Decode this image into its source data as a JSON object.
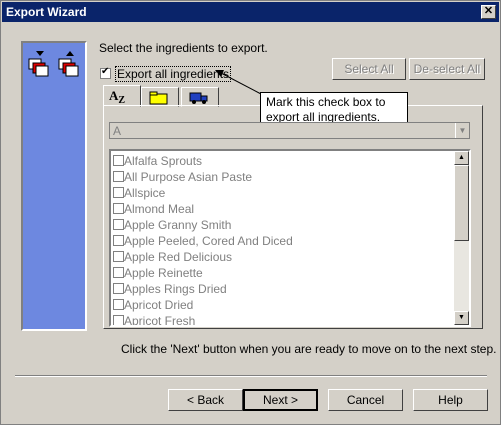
{
  "window": {
    "title": "Export Wizard",
    "close_glyph": "✕"
  },
  "instruction": "Select the ingredients to export.",
  "export_all": {
    "label": "Export all ingredients",
    "checked": true
  },
  "buttons": {
    "select_all": "Select All",
    "deselect_all": "De-select All",
    "back": "< Back",
    "next": "Next >",
    "cancel": "Cancel",
    "help": "Help"
  },
  "tabs": [
    {
      "name": "alphabetical",
      "icon": "az-sort-icon",
      "active": true
    },
    {
      "name": "category",
      "icon": "folder-icon",
      "active": false
    },
    {
      "name": "supplier",
      "icon": "truck-icon",
      "active": false
    }
  ],
  "combo": {
    "value": "A"
  },
  "callout": {
    "line1": "Mark this check box to",
    "line2": "export all ingredients."
  },
  "ingredients": [
    "Alfalfa Sprouts",
    "All Purpose Asian Paste",
    "Allspice",
    "Almond Meal",
    "Apple Granny Smith",
    "Apple Peeled, Cored And Diced",
    "Apple Red Delicious",
    "Apple Reinette",
    "Apples Rings Dried",
    "Apricot Dried",
    "Apricot Fresh"
  ],
  "footer_hint": "Click the 'Next' button when you are ready to move on to the next step.",
  "colors": {
    "title_bar": "#0a246a",
    "side_panel": "#6d88e0",
    "dialog_bg": "#d4d0c8"
  }
}
